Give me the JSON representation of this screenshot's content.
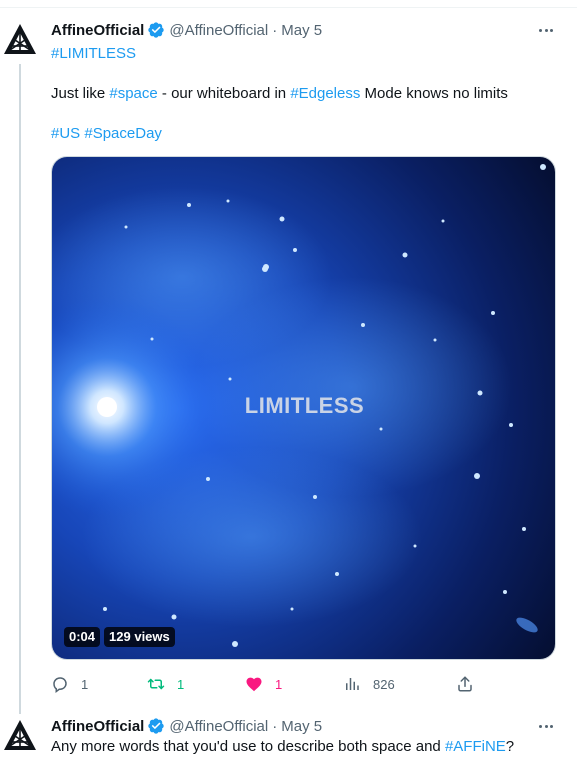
{
  "tweets": [
    {
      "author": {
        "display_name": "AffineOfficial",
        "handle": "@AffineOfficial",
        "verified": true,
        "avatar_icon": "affine-logo-icon"
      },
      "separator": "·",
      "date": "May 5",
      "text_lines": [
        [
          {
            "text": "#LIMITLESS",
            "type": "hashtag"
          }
        ],
        [
          {
            "text": "Just like ",
            "type": "text"
          },
          {
            "text": "#space",
            "type": "hashtag"
          },
          {
            "text": " - our whiteboard in ",
            "type": "text"
          },
          {
            "text": "#Edgeless",
            "type": "hashtag"
          },
          {
            "text": " Mode knows no limits",
            "type": "text"
          }
        ],
        [
          {
            "text": "#US",
            "type": "hashtag"
          },
          {
            "text": " ",
            "type": "text"
          },
          {
            "text": "#SpaceDay",
            "type": "hashtag"
          }
        ]
      ],
      "media": {
        "type": "video",
        "overlay_title": "LIMITLESS",
        "duration": "0:04",
        "views_badge": "129 views"
      },
      "actions": {
        "replies": "1",
        "retweets": "1",
        "likes": "1",
        "liked": true,
        "views": "826"
      }
    },
    {
      "author": {
        "display_name": "AffineOfficial",
        "handle": "@AffineOfficial",
        "verified": true,
        "avatar_icon": "affine-logo-icon"
      },
      "separator": "·",
      "date": "May 5",
      "text_lines": [
        [
          {
            "text": "Any more words that you'd use to describe both space and ",
            "type": "text"
          },
          {
            "text": "#AFFiNE",
            "type": "hashtag"
          },
          {
            "text": "?",
            "type": "text"
          }
        ]
      ]
    }
  ],
  "colors": {
    "accent": "#1d9bf0",
    "text_primary": "#0f1419",
    "text_secondary": "#536471",
    "retweet": "#00ba7c",
    "like": "#f91880"
  }
}
